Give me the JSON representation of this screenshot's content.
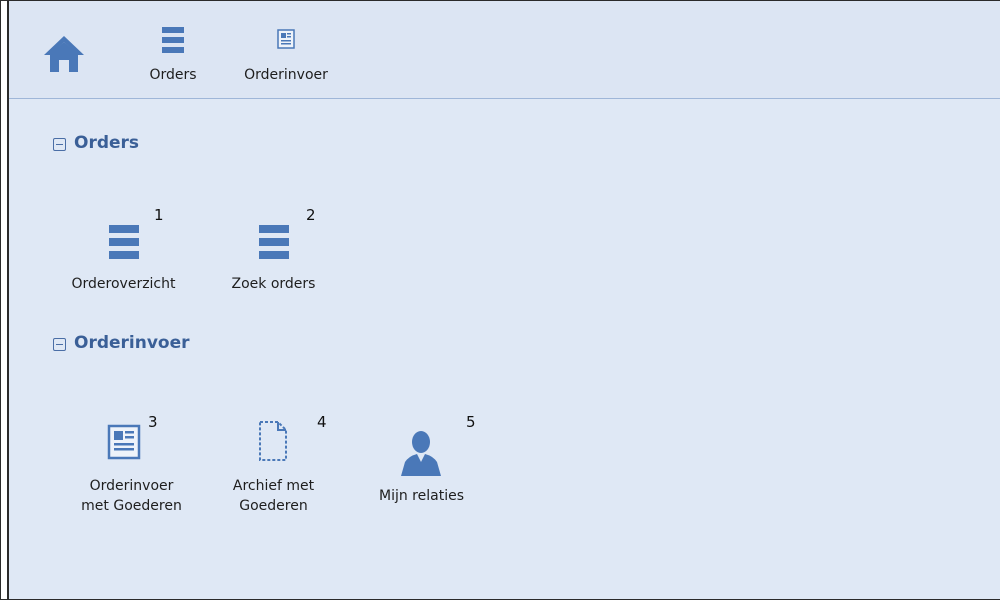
{
  "toolbar": {
    "home_icon": "home-icon",
    "orders_label": "Orders",
    "order_entry_label": "Orderinvoer"
  },
  "sections": [
    {
      "title": "Orders",
      "items": [
        {
          "number": "1",
          "label": "Orderoverzicht",
          "icon": "list-icon"
        },
        {
          "number": "2",
          "label": "Zoek orders",
          "icon": "list-icon"
        }
      ]
    },
    {
      "title": "Orderinvoer",
      "items": [
        {
          "number": "3",
          "label_line1": "Orderinvoer",
          "label_line2": "met Goederen",
          "icon": "form-icon"
        },
        {
          "number": "4",
          "label_line1": "Archief met",
          "label_line2": "Goederen",
          "icon": "dashed-document-icon"
        },
        {
          "number": "5",
          "label": "Mijn relaties",
          "icon": "person-icon"
        }
      ]
    }
  ],
  "colors": {
    "icon_blue": "#4a78b8",
    "header_text": "#3a5f97",
    "background": "#dfe8f5"
  }
}
